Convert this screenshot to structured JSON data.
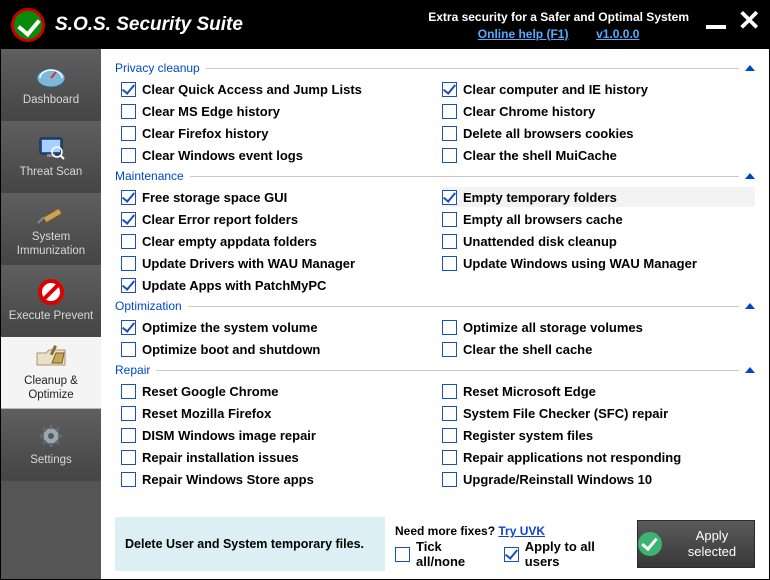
{
  "header": {
    "app_title": "S.O.S. Security Suite",
    "tagline": "Extra security for a Safer and Optimal System",
    "help_link": "Online help (F1)",
    "version": "v1.0.0.0"
  },
  "sidebar": {
    "items": [
      {
        "label": "Dashboard"
      },
      {
        "label": "Threat Scan"
      },
      {
        "label": "System Immunization"
      },
      {
        "label": "Execute Prevent"
      },
      {
        "label": "Cleanup & Optimize"
      },
      {
        "label": "Settings"
      }
    ]
  },
  "groups": [
    {
      "title": "Privacy cleanup",
      "items": [
        {
          "label": "Clear Quick Access and Jump Lists",
          "checked": true
        },
        {
          "label": "Clear computer and IE history",
          "checked": true
        },
        {
          "label": "Clear MS Edge history",
          "checked": false
        },
        {
          "label": "Clear Chrome history",
          "checked": false
        },
        {
          "label": "Clear Firefox history",
          "checked": false
        },
        {
          "label": "Delete all browsers cookies",
          "checked": false
        },
        {
          "label": "Clear Windows event logs",
          "checked": false
        },
        {
          "label": "Clear the shell MuiCache",
          "checked": false
        }
      ]
    },
    {
      "title": "Maintenance",
      "items": [
        {
          "label": "Free storage space GUI",
          "checked": true
        },
        {
          "label": "Empty temporary folders",
          "checked": true,
          "highlight": true
        },
        {
          "label": "Clear Error report folders",
          "checked": true
        },
        {
          "label": "Empty all browsers cache",
          "checked": false
        },
        {
          "label": "Clear empty appdata folders",
          "checked": false
        },
        {
          "label": "Unattended disk cleanup",
          "checked": false
        },
        {
          "label": "Update Drivers with WAU Manager",
          "checked": false
        },
        {
          "label": "Update Windows using WAU Manager",
          "checked": false
        },
        {
          "label": "Update Apps with PatchMyPC",
          "checked": true
        },
        {
          "label": "",
          "checked": null
        }
      ]
    },
    {
      "title": "Optimization",
      "items": [
        {
          "label": "Optimize the system volume",
          "checked": true
        },
        {
          "label": "Optimize all storage volumes",
          "checked": false
        },
        {
          "label": "Optimize boot and shutdown",
          "checked": false
        },
        {
          "label": "Clear the shell cache",
          "checked": false
        }
      ]
    },
    {
      "title": "Repair",
      "items": [
        {
          "label": "Reset Google Chrome",
          "checked": false
        },
        {
          "label": "Reset Microsoft Edge",
          "checked": false
        },
        {
          "label": "Reset Mozilla Firefox",
          "checked": false
        },
        {
          "label": "System File Checker (SFC) repair",
          "checked": false
        },
        {
          "label": "DISM Windows image repair",
          "checked": false
        },
        {
          "label": "Register system files",
          "checked": false
        },
        {
          "label": "Repair installation issues",
          "checked": false
        },
        {
          "label": "Repair applications not responding",
          "checked": false
        },
        {
          "label": "Repair Windows Store apps",
          "checked": false
        },
        {
          "label": "Upgrade/Reinstall Windows 10",
          "checked": false
        }
      ]
    }
  ],
  "footer": {
    "description": "Delete User and System temporary files.",
    "prompt": "Need more fixes? ",
    "prompt_link": "Try UVK",
    "tick_all": {
      "label": "Tick all/none",
      "checked": false
    },
    "apply_all": {
      "label": "Apply to all users",
      "checked": true
    },
    "apply_button": "Apply selected"
  }
}
